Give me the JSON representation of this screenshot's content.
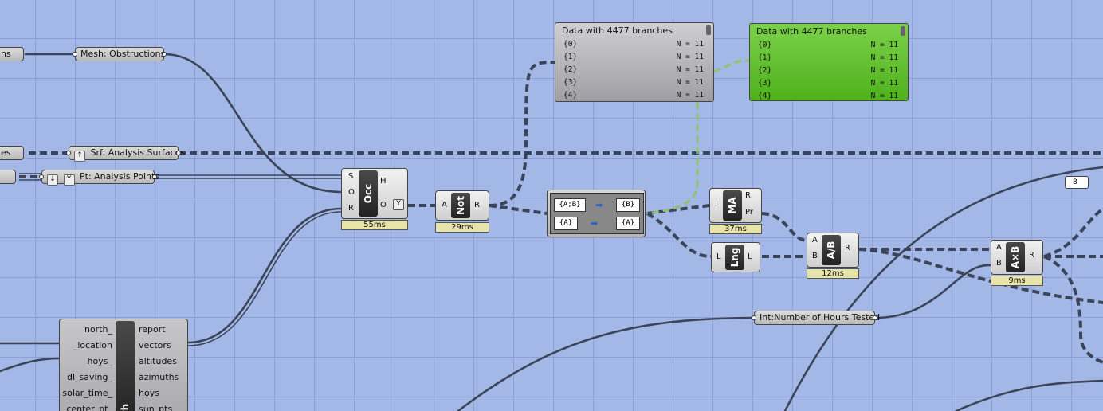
{
  "params": {
    "ns_stub": "ns",
    "es_stub": "es",
    "mesh": "Mesh: Obstructions",
    "srf": "Srf: Analysis Surfaces",
    "pt": "Pt: Analysis Points",
    "int_hours": "Int:Number of Hours Tested",
    "eight": "8"
  },
  "occ": {
    "core": "Occ",
    "inputs": [
      "S",
      "O",
      "R"
    ],
    "outputs": [
      "H",
      "O"
    ],
    "timer": "55ms"
  },
  "not": {
    "core": "Not",
    "input": "A",
    "output": "R",
    "timer": "29ms"
  },
  "ma": {
    "core": "MA",
    "input": "I",
    "outputs": [
      "R",
      "Pr"
    ],
    "timer": "37ms"
  },
  "lng": {
    "core": "Lng",
    "input": "L",
    "output": "L"
  },
  "div": {
    "core": "A/B",
    "inputs": [
      "A",
      "B"
    ],
    "output": "R",
    "timer": "12ms"
  },
  "mul": {
    "core": "A×B",
    "inputs": [
      "A",
      "B"
    ],
    "output": "R",
    "timer": "9ms"
  },
  "path_mapper": {
    "rows": [
      {
        "from": "{A;B}",
        "to": "{B}"
      },
      {
        "from": "{A}",
        "to": "{A}"
      }
    ]
  },
  "panel1": {
    "title": "Data with 4477 branches",
    "rows": [
      {
        "k": "{0}",
        "v": "N = 11"
      },
      {
        "k": "{1}",
        "v": "N = 11"
      },
      {
        "k": "{2}",
        "v": "N = 11"
      },
      {
        "k": "{3}",
        "v": "N = 11"
      },
      {
        "k": "{4}",
        "v": "N = 11"
      }
    ]
  },
  "panel2": {
    "title": "Data with 4477 branches",
    "rows": [
      {
        "k": "{0}",
        "v": "N = 11"
      },
      {
        "k": "{1}",
        "v": "N = 11"
      },
      {
        "k": "{2}",
        "v": "N = 11"
      },
      {
        "k": "{3}",
        "v": "N = 11"
      },
      {
        "k": "{4}",
        "v": "N = 11"
      }
    ]
  },
  "sunpath": {
    "core": "ath",
    "inputs": [
      "north_",
      "_location",
      "hoys_",
      "dl_saving_",
      "solar_time_",
      "_center_pt_"
    ],
    "outputs": [
      "report",
      "vectors",
      "altitudes",
      "azimuths",
      "hoys",
      "sun_pts"
    ]
  },
  "colors": {
    "canvas": "#a3b8e6",
    "panel_green": "#5cc02a",
    "panel_gray": "#a8a8ab",
    "wire": "#3b4458"
  }
}
